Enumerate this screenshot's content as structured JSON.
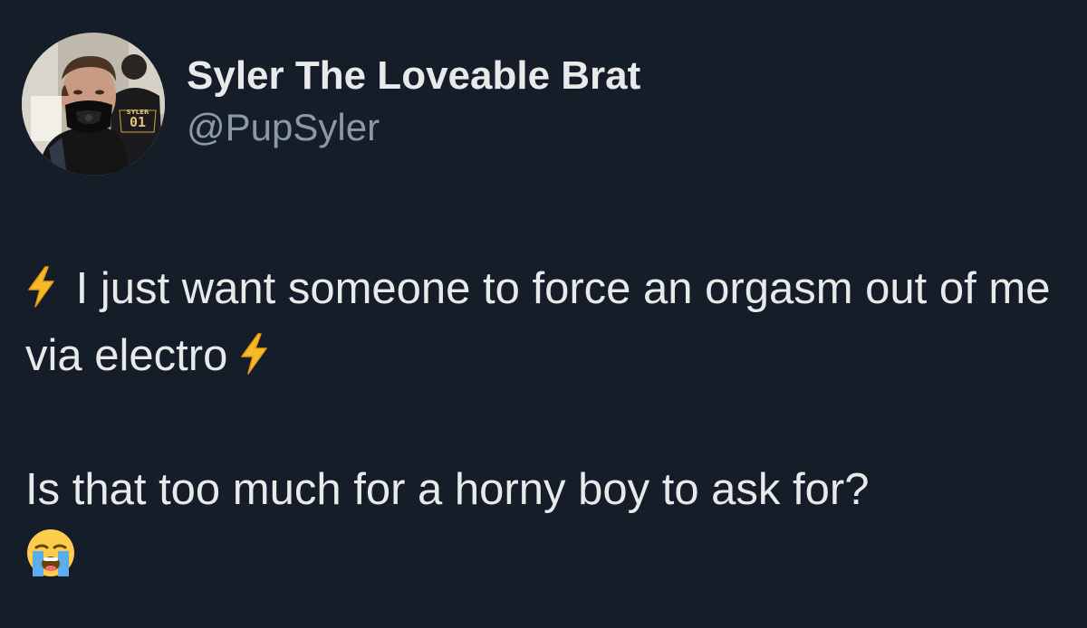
{
  "tweet": {
    "author": {
      "display_name": "Syler The Loveable Brat",
      "handle": "@PupSyler"
    },
    "text": {
      "line1": "I just want someone to force an orgasm out of me via electro",
      "line2": "Is that too much for a horny boy to ask for?"
    },
    "emojis": {
      "bolt": "lightning-bolt",
      "cry": "loudly-crying-face"
    }
  },
  "colors": {
    "background": "#151d28",
    "text": "#e7e9ea",
    "secondary_text": "#8b98a5",
    "bolt": "#f7b928"
  }
}
